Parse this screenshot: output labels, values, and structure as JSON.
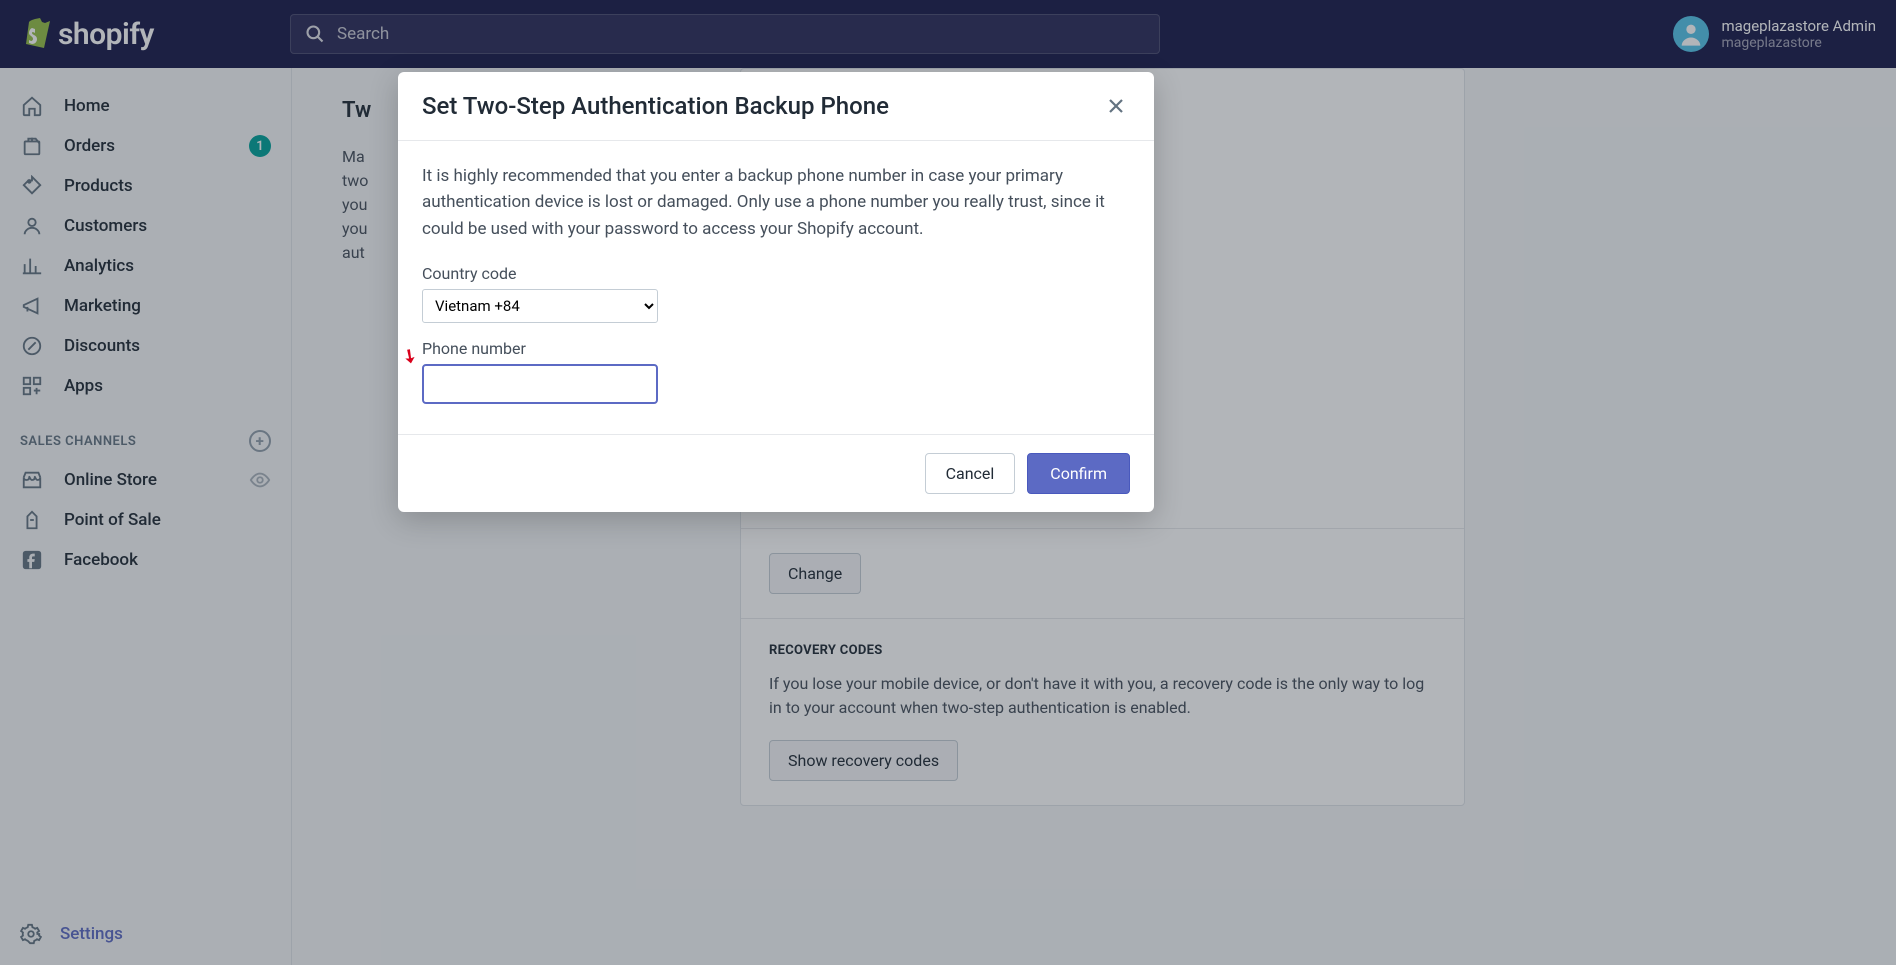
{
  "header": {
    "logo_text": "shopify",
    "search_placeholder": "Search",
    "user_name": "mageplazastore Admin",
    "user_store": "mageplazastore"
  },
  "sidebar": {
    "items": [
      {
        "label": "Home",
        "icon": "home"
      },
      {
        "label": "Orders",
        "icon": "orders",
        "badge": "1"
      },
      {
        "label": "Products",
        "icon": "products"
      },
      {
        "label": "Customers",
        "icon": "customers"
      },
      {
        "label": "Analytics",
        "icon": "analytics"
      },
      {
        "label": "Marketing",
        "icon": "marketing"
      },
      {
        "label": "Discounts",
        "icon": "discounts"
      },
      {
        "label": "Apps",
        "icon": "apps"
      }
    ],
    "section_label": "SALES CHANNELS",
    "channels": [
      {
        "label": "Online Store",
        "icon": "store",
        "trailing": "eye"
      },
      {
        "label": "Point of Sale",
        "icon": "pos"
      },
      {
        "label": "Facebook",
        "icon": "facebook"
      }
    ],
    "settings_label": "Settings"
  },
  "page": {
    "title_partial": "Tw",
    "desc_lines": [
      "Ma",
      "two",
      "you",
      "you",
      "aut"
    ]
  },
  "card": {
    "change_button": "Change",
    "recovery_title": "RECOVERY CODES",
    "recovery_text": "If you lose your mobile device, or don't have it with you, a recovery code is the only way to log in to your account when two-step authentication is enabled.",
    "show_codes_button": "Show recovery codes"
  },
  "modal": {
    "title": "Set Two-Step Authentication Backup Phone",
    "description": "It is highly recommended that you enter a backup phone number in case your primary authentication device is lost or damaged. Only use a phone number you really trust, since it could be used with your password to access your Shopify account.",
    "country_label": "Country code",
    "country_value": "Vietnam +84",
    "phone_label": "Phone number",
    "phone_value": "",
    "cancel": "Cancel",
    "confirm": "Confirm"
  }
}
